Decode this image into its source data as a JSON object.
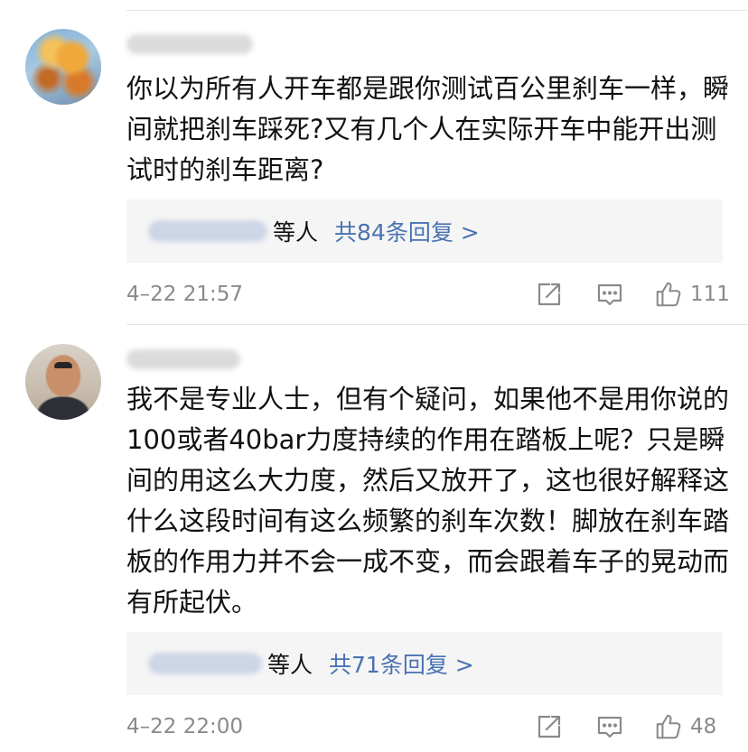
{
  "comments": [
    {
      "text": "你以为所有人开车都是跟你测试百公里刹车一样，瞬间就把刹车踩死?又有几个人在实际开车中能开出测试时的刹车距离?",
      "replies": {
        "others_label": "等人",
        "count_label": "共84条回复 >"
      },
      "timestamp": "4–22 21:57",
      "likes": "111",
      "icons": [
        "share-icon",
        "comment-icon",
        "like-icon"
      ]
    },
    {
      "text": "我不是专业人士，但有个疑问，如果他不是用你说的100或者40bar力度持续的作用在踏板上呢？只是瞬间的用这么大力度，然后又放开了，这也很好解释这什么这段时间有这么频繁的刹车次数！脚放在刹车踏板的作用力并不会一成不变，而会跟着车子的晃动而有所起伏。",
      "replies": {
        "others_label": "等人",
        "count_label": "共71条回复 >"
      },
      "timestamp": "4–22 22:00",
      "likes": "48",
      "icons": [
        "share-icon",
        "comment-icon",
        "like-icon"
      ]
    }
  ],
  "colors": {
    "link": "#4a72b2",
    "meta": "#8a8a8a",
    "reply_bg": "#f5f5f5"
  }
}
